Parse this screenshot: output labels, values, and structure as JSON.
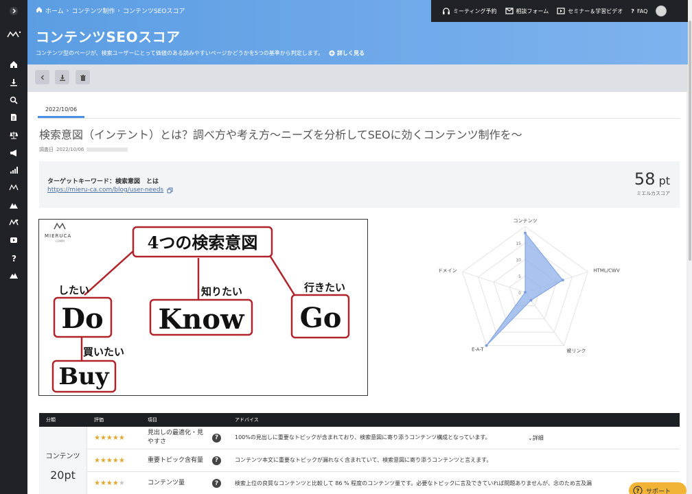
{
  "app": {
    "breadcrumb": [
      "ホーム",
      "コンテンツ制作",
      "コンテンツSEOスコア"
    ],
    "page_title": "コンテンツSEOスコア",
    "page_desc": "コンテンツ型のページが、検索ユーザーにとって価値のある読みやすいページかどうかを5つの基準から判定します。",
    "more_label": "詳しく見る"
  },
  "topbar": {
    "meeting": "ミーティング予約",
    "contact": "相談フォーム",
    "seminar": "セミナー＆学習ビデオ",
    "faq": "FAQ"
  },
  "tab": {
    "date": "2022/10/06"
  },
  "article": {
    "title": "検索意図（インテント）とは？調べ方や考え方～ニーズを分析してSEOに効くコンテンツ制作を～",
    "survey_label": "調査日",
    "survey_date": "2022/10/06"
  },
  "keyword": {
    "label": "ターゲットキーワード：検索意図　とは",
    "url": "https://mieru-ca.com/blog/user-needs"
  },
  "score": {
    "value": "58",
    "unit": "pt",
    "label": "ミエルカスコア"
  },
  "infographic": {
    "logo_text": "MIERUCA",
    "logo_sub": "COMM",
    "center": "4つの検索意図",
    "do_caption": "したい",
    "do": "Do",
    "know_caption": "知りたい",
    "know": "Know",
    "go_caption": "行きたい",
    "go": "Go",
    "buy_caption": "買いたい",
    "buy": "Buy"
  },
  "chart_data": {
    "type": "radar",
    "axes": [
      "コンテンツ",
      "HTML/CWV",
      "被リンク",
      "E-A-T",
      "ドメイン"
    ],
    "tick_labels": [
      "0",
      "5",
      "10",
      "15"
    ],
    "values": [
      18,
      12,
      3,
      20,
      0
    ],
    "max": 20,
    "color": "#8fb0ea"
  },
  "table": {
    "headers": [
      "分類",
      "評価",
      "項目",
      "アドバイス"
    ],
    "category": "コンテンツ",
    "category_score": "20pt",
    "rows": [
      {
        "stars": 5,
        "item": "見出しの最適化・見やすさ",
        "advice": "100%の見出しに重要なトピックが含まれており、検索意図に寄り添うコンテンツ構成となっています。",
        "detail": "詳細"
      },
      {
        "stars": 5,
        "item": "重要トピック含有量",
        "advice": "コンテンツ本文に重要なトピックが漏れなく含まれていて、検索意図に寄り添うコンテンツと言えます。",
        "detail": ""
      },
      {
        "stars": 4,
        "item": "コンテンツ量",
        "advice": "検索上位の良質なコンテンツと比較して 86 % 程度のコンテンツ量です。必要なトピックに言及できていれば問題ありませんが、念のため言及漏",
        "detail": ""
      }
    ]
  },
  "support": {
    "label": "サポート"
  }
}
